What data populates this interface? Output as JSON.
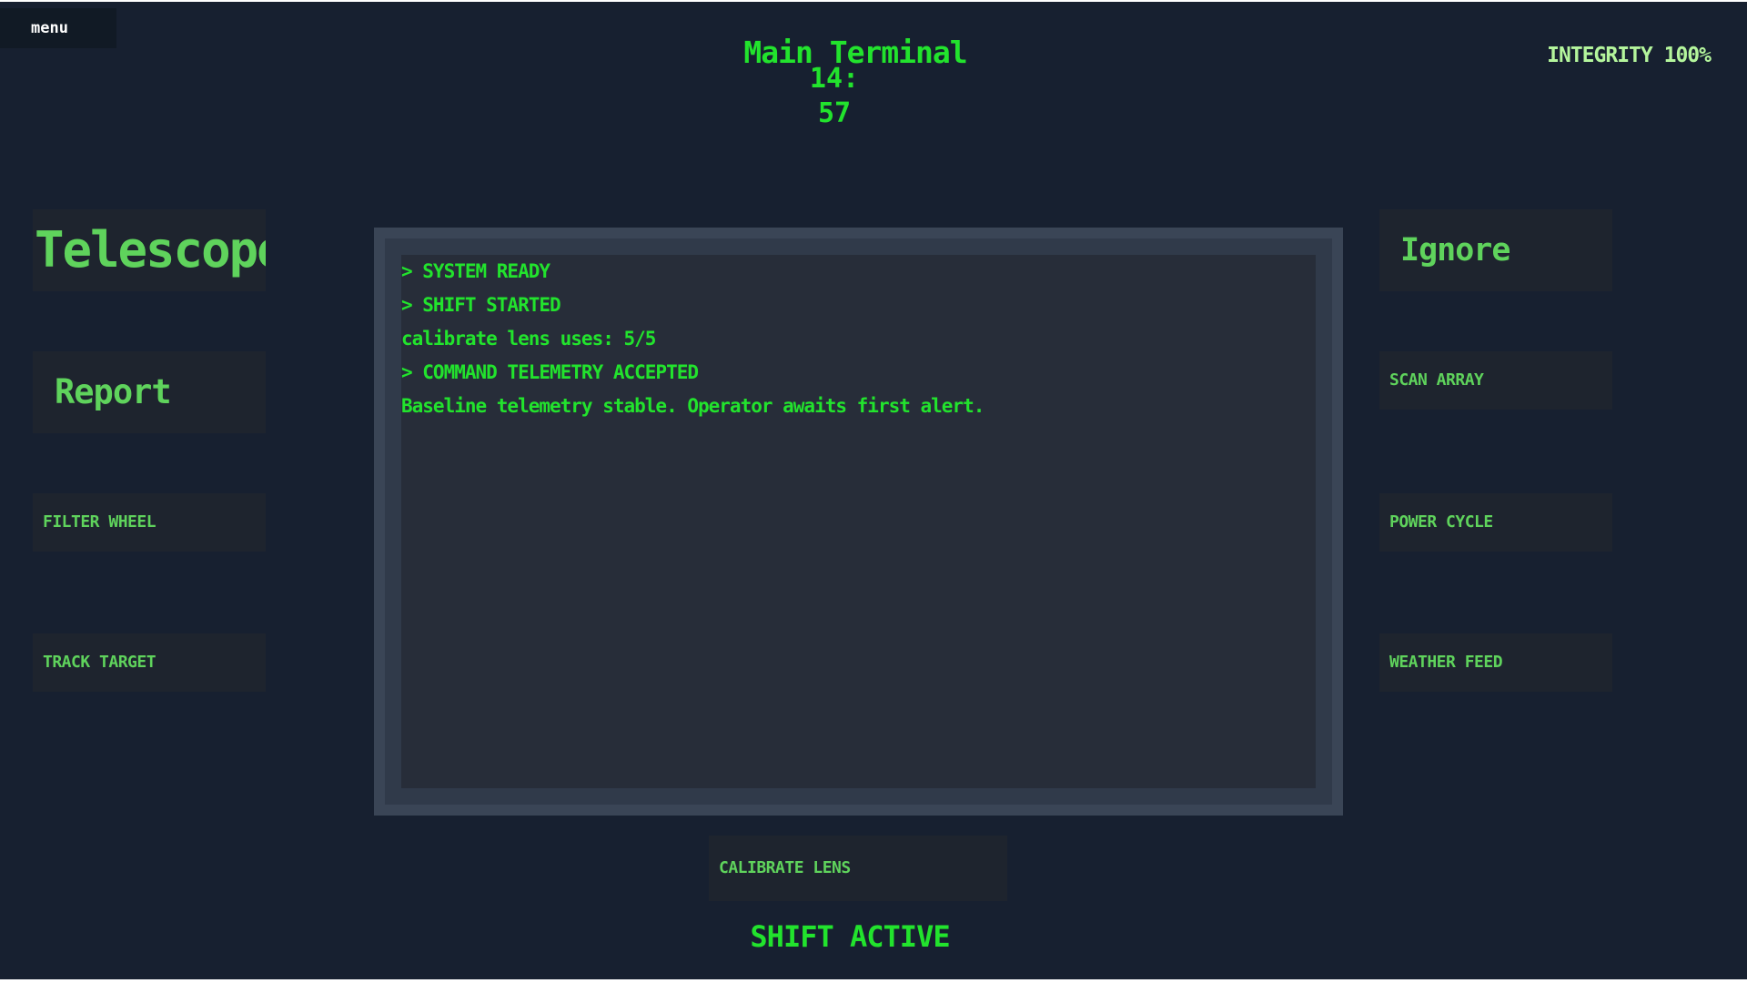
{
  "menu": {
    "label": "menu"
  },
  "header": {
    "title": "Main Terminal",
    "clock": "14:\n57",
    "integrity": "INTEGRITY 100%"
  },
  "left_controls": {
    "telescope": "Telescope",
    "report": "Report",
    "filter_wheel": "FILTER WHEEL",
    "track_target": "TRACK TARGET"
  },
  "right_controls": {
    "ignore": "Ignore",
    "scan_array": "SCAN ARRAY",
    "power_cycle": "POWER CYCLE",
    "weather_feed": "WEATHER FEED"
  },
  "console": {
    "lines": [
      "> SYSTEM READY",
      "> SHIFT STARTED",
      "calibrate lens uses: 5/5",
      "> COMMAND TELEMETRY ACCEPTED",
      "Baseline telemetry stable. Operator awaits first alert."
    ]
  },
  "bottom": {
    "calibrate_lens": "CALIBRATE LENS",
    "status": "SHIFT ACTIVE"
  },
  "colors": {
    "background": "#172030",
    "terminal_green": "#22e32d",
    "button_text": "#5fd35c",
    "button_bg": "#1e242e",
    "integrity_text": "#b4f59c"
  }
}
